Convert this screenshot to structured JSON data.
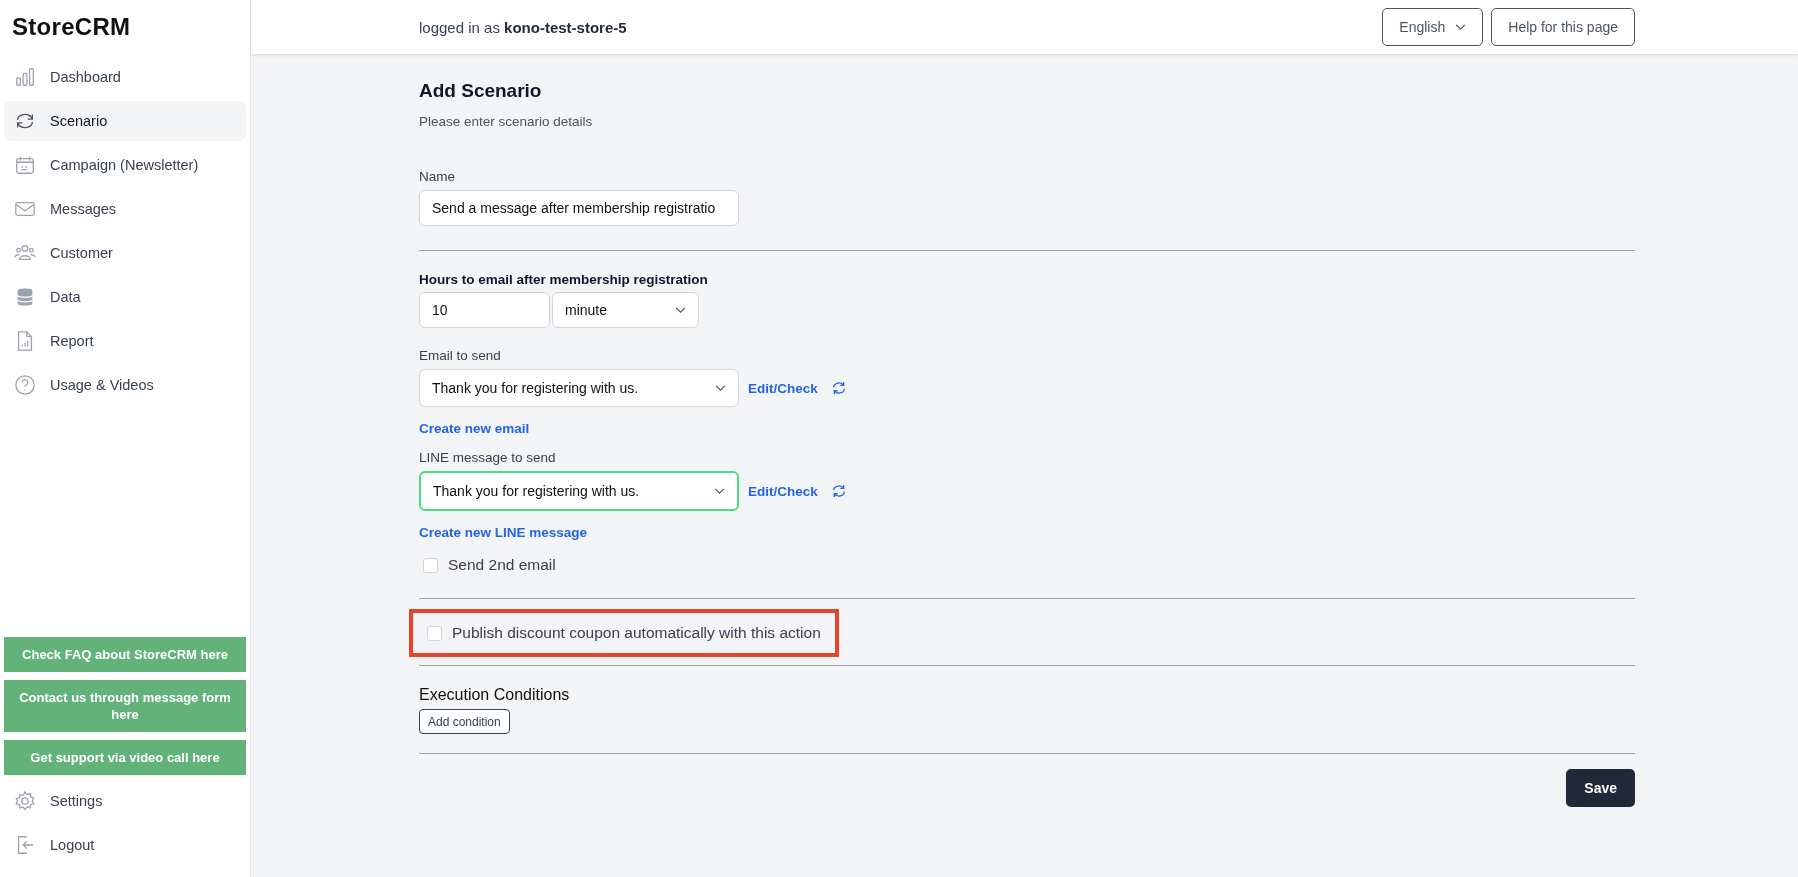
{
  "brand": "StoreCRM",
  "sidebar": {
    "items": [
      {
        "label": "Dashboard",
        "kind": "bars",
        "selected": false
      },
      {
        "label": "Scenario",
        "kind": "cycle",
        "selected": true
      },
      {
        "label": "Campaign (Newsletter)",
        "kind": "calendar",
        "selected": false
      },
      {
        "label": "Messages",
        "kind": "mail",
        "selected": false
      },
      {
        "label": "Customer",
        "kind": "people",
        "selected": false
      },
      {
        "label": "Data",
        "kind": "database",
        "selected": false
      },
      {
        "label": "Report",
        "kind": "report",
        "selected": false
      },
      {
        "label": "Usage & Videos",
        "kind": "help",
        "selected": false
      }
    ],
    "support_links": [
      "Check FAQ about StoreCRM here",
      "Contact us through message form here",
      "Get support via video call here"
    ],
    "bottom_items": [
      {
        "label": "Settings",
        "kind": "gear",
        "selected": false
      },
      {
        "label": "Logout",
        "kind": "logout",
        "selected": false
      }
    ]
  },
  "header": {
    "login_prefix": "logged in as",
    "user": "kono-test-store-5",
    "language": "English",
    "help": "Help for this page"
  },
  "page": {
    "title": "Add Scenario",
    "subtitle": "Please enter scenario details"
  },
  "form": {
    "name_label": "Name",
    "name_value": "Send a message after membership registratio",
    "hours_label": "Hours to email after membership registration",
    "hours_value": "10",
    "unit_value": "minute",
    "email_label": "Email to send",
    "email_value": "Thank you for registering with us.",
    "email_focused": false,
    "email_edit": "Edit/Check",
    "email_create": "Create new email",
    "line_label": "LINE message to send",
    "line_value": "Thank you for registering with us.",
    "line_focused": true,
    "line_edit": "Edit/Check",
    "line_create": "Create new LINE message",
    "second_email": {
      "label": "Send 2nd email",
      "checked": false
    },
    "coupon": {
      "label": "Publish discount coupon automatically with this action",
      "checked": false,
      "highlighted": true
    },
    "conditions_title": "Execution Conditions",
    "add_condition": "Add condition",
    "save": "Save"
  }
}
